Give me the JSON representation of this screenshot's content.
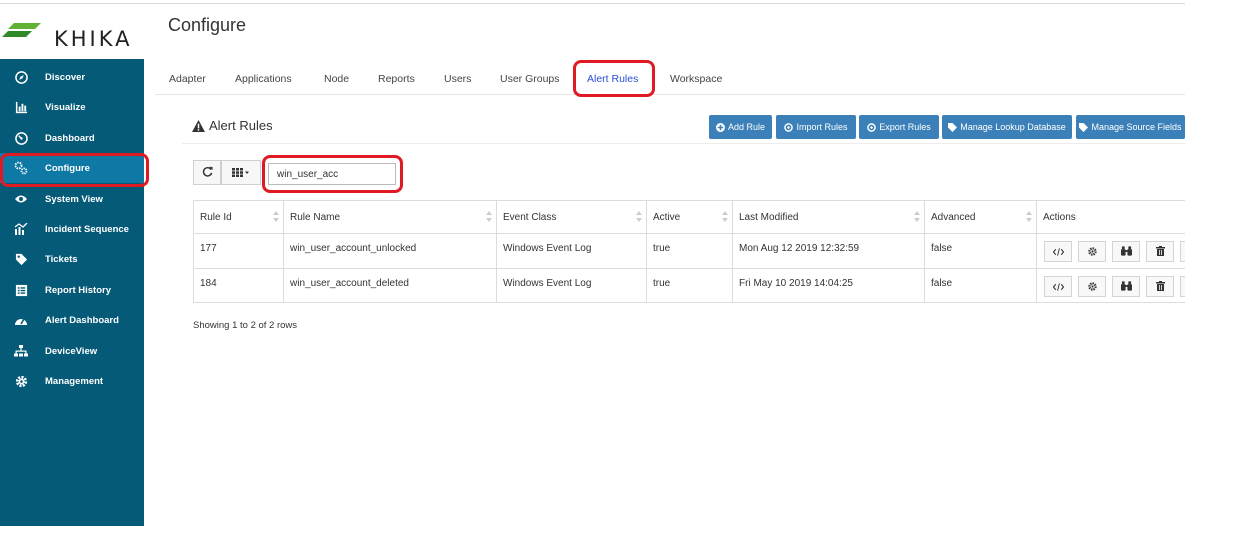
{
  "app": {
    "brand": "KHIKA",
    "page_title": "Configure"
  },
  "sidebar": {
    "items": [
      {
        "label": "Discover",
        "icon": "compass-icon"
      },
      {
        "label": "Visualize",
        "icon": "bar-chart-icon"
      },
      {
        "label": "Dashboard",
        "icon": "dashboard-gauge-icon"
      },
      {
        "label": "Configure",
        "icon": "cogs-icon",
        "active": true
      },
      {
        "label": "System View",
        "icon": "eye-icon"
      },
      {
        "label": "Incident Sequence",
        "icon": "timeline-chart-icon"
      },
      {
        "label": "Tickets",
        "icon": "tag-icon"
      },
      {
        "label": "Report History",
        "icon": "list-alt-icon"
      },
      {
        "label": "Alert Dashboard",
        "icon": "tachometer-icon"
      },
      {
        "label": "DeviceView",
        "icon": "sitemap-icon"
      },
      {
        "label": "Management",
        "icon": "gear-icon"
      }
    ]
  },
  "tabs": [
    "Adapter",
    "Applications",
    "Node",
    "Reports",
    "Users",
    "User Groups",
    "Alert Rules",
    "Workspace"
  ],
  "active_tab": "Alert Rules",
  "panel": {
    "title": "Alert Rules",
    "buttons": {
      "add": "Add Rule",
      "import": "Import Rules",
      "export": "Export Rules",
      "lookup": "Manage Lookup Database",
      "source": "Manage Source Fields"
    }
  },
  "search": {
    "value": "win_user_acc"
  },
  "table": {
    "columns": [
      "Rule Id",
      "Rule Name",
      "Event Class",
      "Active",
      "Last Modified",
      "Advanced",
      "Actions"
    ],
    "rows": [
      {
        "id": "177",
        "name": "win_user_account_unlocked",
        "event_class": "Windows Event Log",
        "active": "true",
        "modified": "Mon Aug 12 2019 12:32:59",
        "advanced": "false"
      },
      {
        "id": "184",
        "name": "win_user_account_deleted",
        "event_class": "Windows Event Log",
        "active": "true",
        "modified": "Fri May 10 2019 14:04:25",
        "advanced": "false"
      }
    ]
  },
  "footer": "Showing 1 to 2 of 2 rows",
  "colors": {
    "sidebar": "#055a78",
    "sidebar_active": "#0f79a6",
    "button": "#3b80b8",
    "highlight": "#e01a22",
    "active_tab": "#2a4fd6"
  }
}
